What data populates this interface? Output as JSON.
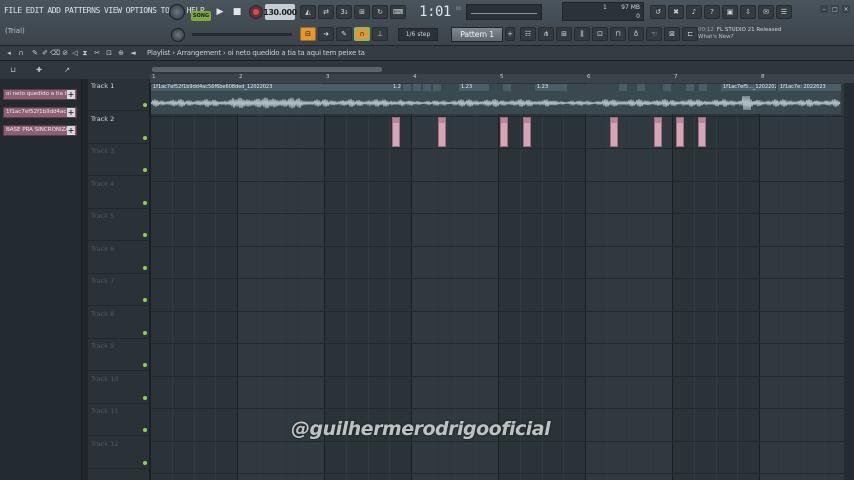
{
  "menu": [
    "FILE",
    "EDIT",
    "ADD",
    "PATTERNS",
    "VIEW",
    "OPTIONS",
    "TOOLS",
    "HELP"
  ],
  "trial": "(Trial)",
  "transport": {
    "song_mode": "SONG",
    "tempo": "130.000",
    "time": "1:01",
    "time_sub": "00",
    "snap": "1/6 step",
    "pattern": "Pattern 1"
  },
  "cpu": {
    "cpu": "1",
    "mem": "97 MB",
    "poly": "0"
  },
  "news": {
    "time": "00:12",
    "headline": "FL STUDIO 21 Released",
    "link": "What's New?"
  },
  "playlist": {
    "breadcrumb": "Playlist › Arrangement › oi neto quedido a tia ta aqui tem peixe ta"
  },
  "picker": [
    "oi neto quedido a tia t...",
    "1f1ac7ef52f1b9dd4ac...",
    "BASE PRA SINCRONIZAR"
  ],
  "tracks": [
    "Track 1",
    "Track 2",
    "Track 3",
    "Track 4",
    "Track 5",
    "Track 6",
    "Track 7",
    "Track 8",
    "Track 9",
    "Track 10",
    "Track 11",
    "Track 12"
  ],
  "ruler_bars": [
    "1",
    "2",
    "3",
    "4",
    "5",
    "6",
    "7",
    "8"
  ],
  "clip_labels": [
    "1f1ac7ef52f1b9dd4ac56f6be608ded_12022023",
    "1.23",
    "1.23",
    "1.23",
    "1f1ac7ef5..._12022023",
    "1f1ac7e: 2022023"
  ],
  "watermark": "@guilhermerodrigooficial",
  "colors": {
    "accent_orange": "#e49832",
    "pattern_clip": "#d6a6b7",
    "audio_clip": "#3a4950",
    "picker_item": "#8c5f72",
    "led_green": "#8fd14f"
  }
}
